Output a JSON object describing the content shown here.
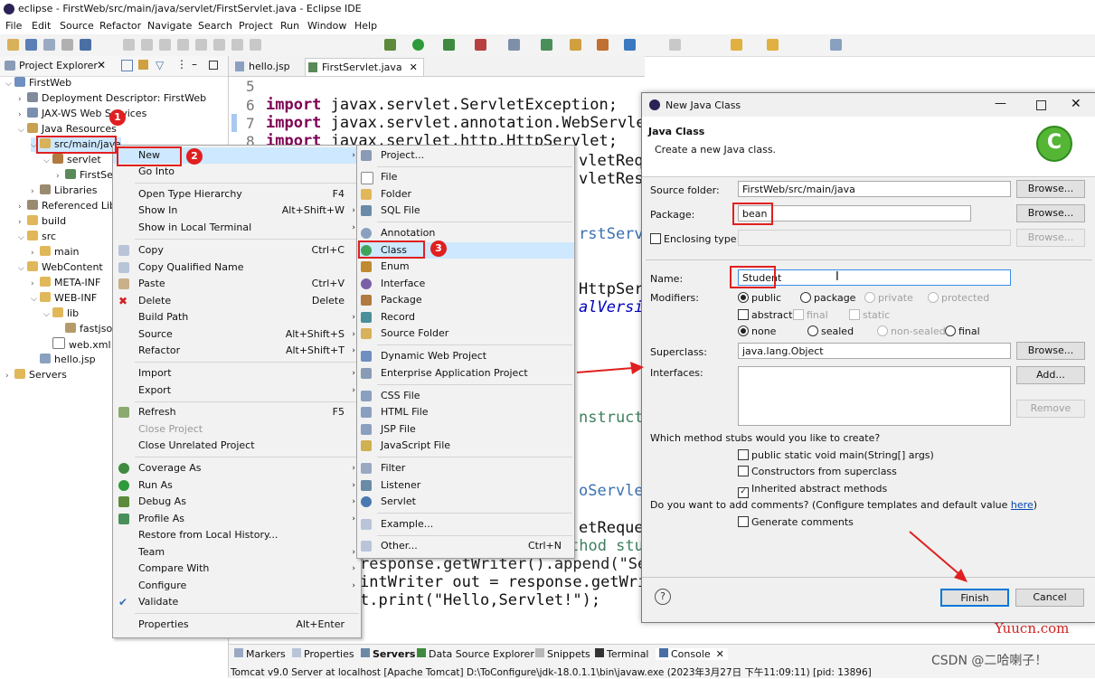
{
  "window": {
    "title": "eclipse - FirstWeb/src/main/java/servlet/FirstServlet.java - Eclipse IDE"
  },
  "menubar": [
    "File",
    "Edit",
    "Source",
    "Refactor",
    "Navigate",
    "Search",
    "Project",
    "Run",
    "Window",
    "Help"
  ],
  "project_explorer": {
    "title": "Project Explorer",
    "items": [
      "FirstWeb",
      "Deployment Descriptor: FirstWeb",
      "JAX-WS Web Services",
      "Java Resources",
      "src/main/java",
      "servlet",
      "FirstServlet.java",
      "Libraries",
      "Referenced Libraries",
      "build",
      "src",
      "main",
      "WebContent",
      "META-INF",
      "WEB-INF",
      "lib",
      "fastjson",
      "web.xml",
      "hello.jsp",
      "Servers"
    ]
  },
  "editor": {
    "tabs": [
      "hello.jsp",
      "FirstServlet.java"
    ],
    "line_numbers": [
      "5",
      "6",
      "7",
      "8"
    ],
    "code_lines": [
      {
        "kw": "import",
        "text": " javax.servlet.ServletException;"
      },
      {
        "kw": "import",
        "text": " javax.servlet.annotation.WebServlet;"
      },
      {
        "kw": "import",
        "text": " javax.servlet.http.HttpServlet;"
      }
    ],
    "fragments": [
      "vletRequest",
      "vletResponse",
      "rstServlet",
      "HttpServlet",
      "alVersion",
      "nstructor",
      "oServlet",
      "etRequest",
      "thod stub",
      "response.getWriter().append(\"Se",
      "intWriter out = response.getWri",
      "t.print(\"Hello,Servlet!\");"
    ]
  },
  "context_menu": {
    "items": [
      {
        "label": "New",
        "shortcut": "",
        "arrow": true,
        "highlight": true
      },
      {
        "label": "Go Into",
        "shortcut": ""
      },
      {
        "label": "Open Type Hierarchy",
        "shortcut": "F4"
      },
      {
        "label": "Show In",
        "shortcut": "Alt+Shift+W",
        "arrow": true
      },
      {
        "label": "Show in Local Terminal",
        "shortcut": "",
        "arrow": true
      },
      {
        "label": "Copy",
        "shortcut": "Ctrl+C"
      },
      {
        "label": "Copy Qualified Name",
        "shortcut": ""
      },
      {
        "label": "Paste",
        "shortcut": "Ctrl+V"
      },
      {
        "label": "Delete",
        "shortcut": "Delete"
      },
      {
        "label": "Build Path",
        "shortcut": "",
        "arrow": true
      },
      {
        "label": "Source",
        "shortcut": "Alt+Shift+S",
        "arrow": true
      },
      {
        "label": "Refactor",
        "shortcut": "Alt+Shift+T",
        "arrow": true
      },
      {
        "label": "Import",
        "shortcut": "",
        "arrow": true
      },
      {
        "label": "Export",
        "shortcut": "",
        "arrow": true
      },
      {
        "label": "Refresh",
        "shortcut": "F5"
      },
      {
        "label": "Close Project",
        "shortcut": "",
        "disabled": true
      },
      {
        "label": "Close Unrelated Project",
        "shortcut": ""
      },
      {
        "label": "Coverage As",
        "shortcut": "",
        "arrow": true
      },
      {
        "label": "Run As",
        "shortcut": "",
        "arrow": true
      },
      {
        "label": "Debug As",
        "shortcut": "",
        "arrow": true
      },
      {
        "label": "Profile As",
        "shortcut": "",
        "arrow": true
      },
      {
        "label": "Restore from Local History...",
        "shortcut": ""
      },
      {
        "label": "Team",
        "shortcut": "",
        "arrow": true
      },
      {
        "label": "Compare With",
        "shortcut": "",
        "arrow": true
      },
      {
        "label": "Configure",
        "shortcut": "",
        "arrow": true
      },
      {
        "label": "Validate",
        "shortcut": ""
      },
      {
        "label": "Properties",
        "shortcut": "Alt+Enter"
      }
    ]
  },
  "new_submenu": {
    "items": [
      "Project...",
      "File",
      "Folder",
      "SQL File",
      "Annotation",
      "Class",
      "Enum",
      "Interface",
      "Package",
      "Record",
      "Source Folder",
      "Dynamic Web Project",
      "Enterprise Application Project",
      "CSS File",
      "HTML File",
      "JSP File",
      "JavaScript File",
      "Filter",
      "Listener",
      "Servlet",
      "Example...",
      "Other..."
    ],
    "other_shortcut": "Ctrl+N"
  },
  "dialog": {
    "title": "New Java Class",
    "heading": "Java Class",
    "subtitle": "Create a new Java class.",
    "source_folder_label": "Source folder:",
    "source_folder_value": "FirstWeb/src/main/java",
    "package_label": "Package:",
    "package_value": "bean",
    "enclosing_label": "Enclosing type:",
    "name_label": "Name:",
    "name_value": "Student",
    "modifiers_label": "Modifiers:",
    "modifiers_row1": [
      "public",
      "package",
      "private",
      "protected"
    ],
    "modifiers_row2": [
      "abstract",
      "final",
      "static"
    ],
    "modifiers_row3": [
      "none",
      "sealed",
      "non-sealed",
      "final"
    ],
    "superclass_label": "Superclass:",
    "superclass_value": "java.lang.Object",
    "interfaces_label": "Interfaces:",
    "browse": "Browse...",
    "add": "Add...",
    "remove": "Remove",
    "stubs_question": "Which method stubs would you like to create?",
    "stubs": [
      "public static void main(String[] args)",
      "Constructors from superclass",
      "Inherited abstract methods"
    ],
    "comments_question": "Do you want to add comments? (Configure templates and default value ",
    "comments_link": "here",
    "comments_end": ")",
    "generate_comments": "Generate comments",
    "finish": "Finish",
    "cancel": "Cancel"
  },
  "badges": [
    "1",
    "2",
    "3"
  ],
  "bottom_tabs": [
    "Markers",
    "Properties",
    "Servers",
    "Data Source Explorer",
    "Snippets",
    "Terminal",
    "Console"
  ],
  "console_status": "Tomcat v9.0 Server at localhost [Apache Tomcat] D:\\ToConfigure\\jdk-18.0.1.1\\bin\\javaw.exe  (2023年3月27日 下午11:09:11) [pid: 13896]",
  "watermarks": [
    "Yuucn.com",
    "CSDN @二哈喇子！"
  ]
}
